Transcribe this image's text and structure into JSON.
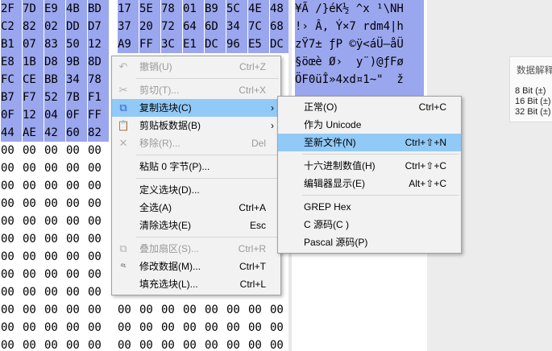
{
  "hex_rows": [
    {
      "cells": [
        "2F",
        "7D",
        "E9",
        "4B",
        "BD",
        "17",
        "5E",
        "78",
        "01",
        "B9",
        "5C",
        "4E",
        "48"
      ],
      "selected": true
    },
    {
      "cells": [
        "C2",
        "82",
        "02",
        "DD",
        "D7",
        "37",
        "20",
        "72",
        "64",
        "6D",
        "34",
        "7C",
        "68"
      ],
      "selected": true
    },
    {
      "cells": [
        "B1",
        "07",
        "83",
        "50",
        "12",
        "A9",
        "FF",
        "3C",
        "E1",
        "DC",
        "96",
        "E5",
        "DC"
      ],
      "selected": true
    },
    {
      "cells": [
        "E8",
        "1B",
        "D8",
        "9B",
        "8D",
        "",
        "",
        "",
        "",
        "",
        "",
        "",
        ""
      ],
      "selected": true
    },
    {
      "cells": [
        "FC",
        "CE",
        "BB",
        "34",
        "78",
        "",
        "",
        "",
        "",
        "",
        "",
        "",
        ""
      ],
      "selected": true
    },
    {
      "cells": [
        "B7",
        "F7",
        "52",
        "7B",
        "F1",
        "",
        "",
        "",
        "",
        "",
        "",
        "",
        ""
      ],
      "selected": true
    },
    {
      "cells": [
        "0F",
        "12",
        "04",
        "0F",
        "FF",
        "",
        "",
        "",
        "",
        "",
        "",
        "",
        ""
      ],
      "selected": true
    },
    {
      "cells": [
        "44",
        "AE",
        "42",
        "60",
        "82",
        "",
        "",
        "",
        "",
        "",
        "",
        "",
        ""
      ],
      "selected": true
    },
    {
      "cells": [
        "00",
        "00",
        "00",
        "00",
        "00",
        "",
        "",
        "",
        "",
        "",
        "",
        "",
        ""
      ],
      "selected": false
    },
    {
      "cells": [
        "00",
        "00",
        "00",
        "00",
        "00",
        "",
        "",
        "",
        "",
        "",
        "",
        "",
        ""
      ],
      "selected": false
    },
    {
      "cells": [
        "00",
        "00",
        "00",
        "00",
        "00",
        "",
        "",
        "",
        "",
        "",
        "",
        "",
        ""
      ],
      "selected": false
    },
    {
      "cells": [
        "00",
        "00",
        "00",
        "00",
        "00",
        "",
        "",
        "",
        "",
        "",
        "",
        "",
        ""
      ],
      "selected": false
    },
    {
      "cells": [
        "00",
        "00",
        "00",
        "00",
        "00",
        "",
        "",
        "",
        "",
        "",
        "",
        "",
        ""
      ],
      "selected": false
    },
    {
      "cells": [
        "00",
        "00",
        "00",
        "00",
        "00",
        "",
        "",
        "",
        "",
        "",
        "",
        "",
        ""
      ],
      "selected": false
    },
    {
      "cells": [
        "00",
        "00",
        "00",
        "00",
        "00",
        "",
        "",
        "",
        "",
        "",
        "",
        "",
        ""
      ],
      "selected": false
    },
    {
      "cells": [
        "00",
        "00",
        "00",
        "00",
        "00",
        "",
        "",
        "",
        "",
        "",
        "",
        "",
        ""
      ],
      "selected": false
    },
    {
      "cells": [
        "00",
        "00",
        "00",
        "00",
        "00",
        "",
        "",
        "",
        "",
        "",
        "",
        "",
        ""
      ],
      "selected": false
    },
    {
      "cells": [
        "00",
        "00",
        "00",
        "00",
        "00",
        "00",
        "00",
        "00",
        "00",
        "00",
        "00",
        "00",
        "00"
      ],
      "selected": false
    },
    {
      "cells": [
        "00",
        "00",
        "00",
        "00",
        "00",
        "00",
        "00",
        "00",
        "00",
        "00",
        "00",
        "00",
        "00"
      ],
      "selected": false
    },
    {
      "cells": [
        "00",
        "00",
        "00",
        "00",
        "00",
        "00",
        "00",
        "00",
        "00",
        "00",
        "00",
        "00",
        "00"
      ],
      "selected": false
    }
  ],
  "text_rows": [
    {
      "text": "¥Ã /}éK½ ^x ¹\\NH",
      "selected": true
    },
    {
      "text": "!› Â, Ý×7 rdm4|h",
      "selected": true
    },
    {
      "text": "zŸ7± ƒP ©ÿ<áÜ–åÜ",
      "selected": true
    },
    {
      "text": "§öœè Ø›  y¨)@ƒFø",
      "selected": true
    },
    {
      "text": "ÖF0üÎ»4xd¤1~\"  ž",
      "selected": true
    },
    {
      "text": "",
      "selected": true
    },
    {
      "text": "",
      "selected": true
    },
    {
      "text": "",
      "selected": true
    }
  ],
  "interpreter": {
    "title": "数据解释",
    "bits": [
      "8 Bit (±)",
      "16 Bit (±)",
      "32 Bit (±)"
    ]
  },
  "context_menu": {
    "items": [
      {
        "type": "item",
        "icon": "undo-icon",
        "glyph": "↶",
        "label": "撤销(U)",
        "shortcut": "Ctrl+Z",
        "disabled": true,
        "name": "menu-undo"
      },
      {
        "type": "sep"
      },
      {
        "type": "item",
        "icon": "scissors-icon",
        "glyph": "✂",
        "label": "剪切(T)...",
        "shortcut": "Ctrl+X",
        "disabled": true,
        "name": "menu-cut"
      },
      {
        "type": "item",
        "icon": "copy-icon",
        "glyph": "⧉",
        "label": "复制选块(C)",
        "shortcut": "",
        "arrow": "›",
        "disabled": false,
        "highlight": true,
        "name": "menu-copy-block"
      },
      {
        "type": "item",
        "icon": "clipboard-icon",
        "glyph": "📋",
        "label": "剪贴板数据(B)",
        "shortcut": "",
        "arrow": "›",
        "disabled": false,
        "name": "menu-clipboard-data"
      },
      {
        "type": "item",
        "icon": "remove-icon",
        "glyph": "✕",
        "label": "移除(R)...",
        "shortcut": "Del",
        "disabled": true,
        "name": "menu-remove"
      },
      {
        "type": "sep"
      },
      {
        "type": "item",
        "icon": "",
        "glyph": "",
        "label": "粘贴 0 字节(P)...",
        "shortcut": "",
        "disabled": false,
        "name": "menu-paste-zero-bytes"
      },
      {
        "type": "sep"
      },
      {
        "type": "item",
        "icon": "",
        "glyph": "",
        "label": "定义选块(D)...",
        "shortcut": "",
        "disabled": false,
        "name": "menu-define-block"
      },
      {
        "type": "item",
        "icon": "",
        "glyph": "",
        "label": "全选(A)",
        "shortcut": "Ctrl+A",
        "disabled": false,
        "name": "menu-select-all"
      },
      {
        "type": "item",
        "icon": "",
        "glyph": "",
        "label": "清除选块(E)",
        "shortcut": "Esc",
        "disabled": false,
        "name": "menu-clear-block"
      },
      {
        "type": "sep"
      },
      {
        "type": "item",
        "icon": "overlay-sector-icon",
        "glyph": "⧉",
        "label": "叠加扇区(S)...",
        "shortcut": "Ctrl+R",
        "disabled": true,
        "name": "menu-overlay-sector"
      },
      {
        "type": "item",
        "icon": "binary-data-icon",
        "glyph": "⁰¹",
        "label": "修改数据(M)...",
        "shortcut": "Ctrl+T",
        "disabled": false,
        "name": "menu-modify-data"
      },
      {
        "type": "item",
        "icon": "",
        "glyph": "",
        "label": "填充选块(L)...",
        "shortcut": "Ctrl+L",
        "disabled": false,
        "name": "menu-fill-block"
      }
    ]
  },
  "submenu": {
    "items": [
      {
        "type": "item",
        "label": "正常(O)",
        "shortcut": "Ctrl+C",
        "name": "sub-normal"
      },
      {
        "type": "item",
        "label": "作为 Unicode",
        "shortcut": "",
        "name": "sub-as-unicode"
      },
      {
        "type": "item",
        "label": "至新文件(N)",
        "shortcut": "Ctrl+⇧+N",
        "highlight": true,
        "name": "sub-to-new-file"
      },
      {
        "type": "sep"
      },
      {
        "type": "item",
        "label": "十六进制数值(H)",
        "shortcut": "Ctrl+⇧+C",
        "name": "sub-hex-values"
      },
      {
        "type": "item",
        "label": "编辑器显示(E)",
        "shortcut": "Alt+⇧+C",
        "name": "sub-editor-display"
      },
      {
        "type": "sep"
      },
      {
        "type": "item",
        "label": "GREP Hex",
        "shortcut": "",
        "name": "sub-grep-hex"
      },
      {
        "type": "item",
        "label": "C 源码(C )",
        "shortcut": "",
        "name": "sub-c-source"
      },
      {
        "type": "item",
        "label": "Pascal 源码(P)",
        "shortcut": "",
        "name": "sub-pascal-source"
      }
    ]
  },
  "colors": {
    "selection": "#9aa6ee",
    "menu_highlight": "#91c9f7",
    "menu_bg": "#f2f2f2"
  }
}
